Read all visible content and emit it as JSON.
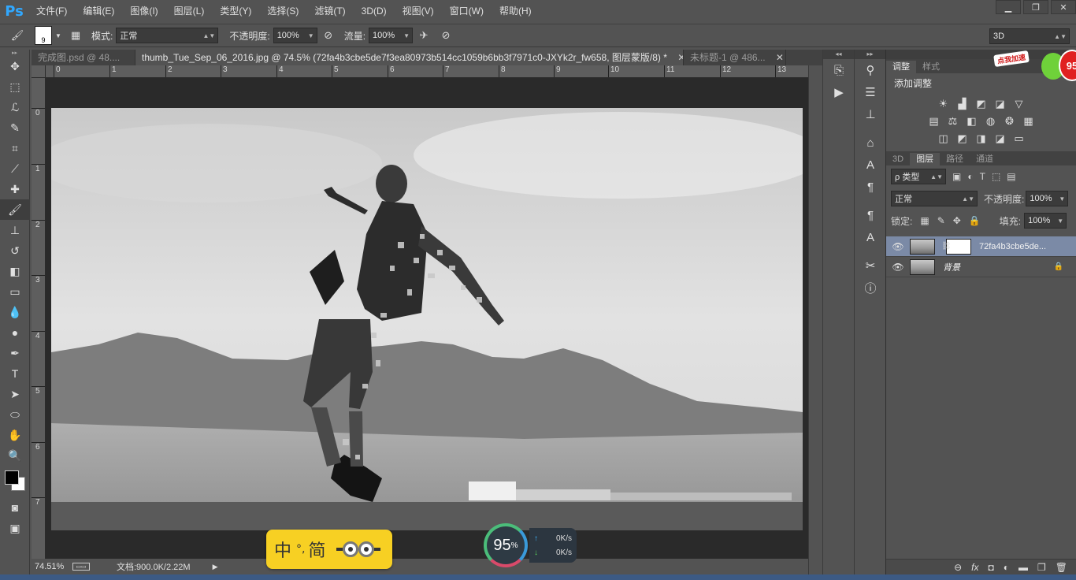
{
  "app": {
    "logo": "Ps",
    "menu": [
      "文件(F)",
      "编辑(E)",
      "图像(I)",
      "图层(L)",
      "类型(Y)",
      "选择(S)",
      "滤镜(T)",
      "3D(D)",
      "视图(V)",
      "窗口(W)",
      "帮助(H)"
    ],
    "window_controls": [
      "▁",
      "❐",
      "✕"
    ]
  },
  "options": {
    "brush_size": "9",
    "mode_label": "模式:",
    "mode_value": "正常",
    "opacity_label": "不透明度:",
    "opacity_value": "100%",
    "flow_label": "流量:",
    "flow_value": "100%",
    "workspace": "3D"
  },
  "tabs": [
    {
      "title": "完成图.psd @ 48....",
      "close": "✕"
    },
    {
      "title": "thumb_Tue_Sep_06_2016.jpg @ 74.5% (72fa4b3cbe5de7f3ea80973b514cc1059b6bb3f7971c0-JXYk2r_fw658, 图层蒙版/8) *",
      "close": "✕"
    },
    {
      "title": "未标题-1 @ 486...",
      "close": "✕"
    }
  ],
  "ruler_top": [
    "0",
    "1",
    "2",
    "3",
    "4",
    "5",
    "6",
    "7",
    "8",
    "9",
    "10",
    "11",
    "12",
    "13"
  ],
  "ruler_left": [
    "0",
    "1",
    "2",
    "3",
    "4",
    "5",
    "6",
    "7"
  ],
  "status": {
    "zoom": "74.51%",
    "doc": "文档:900.0K/2.22M"
  },
  "ime": {
    "lang": "中",
    "punct": "°,",
    "mode": "简"
  },
  "speed": {
    "percent": "95",
    "unit": "%",
    "up": "0K/s",
    "down": "0K/s"
  },
  "panels": {
    "adjust_tabs": [
      "调整",
      "样式"
    ],
    "adjust_title": "添加调整",
    "layer_tabs": [
      "3D",
      "图层",
      "路径",
      "通道"
    ],
    "filter_label": "ρ 类型",
    "blend_mode": "正常",
    "opacity_label": "不透明度:",
    "opacity_value": "100%",
    "lock_label": "锁定:",
    "fill_label": "填充:",
    "fill_value": "100%",
    "layers": [
      {
        "name": "72fa4b3cbe5de..."
      },
      {
        "name": "背景"
      }
    ],
    "bottom_icons": [
      "⊖",
      "fx",
      "◘",
      "◐",
      "▬",
      "❐",
      "🗑"
    ]
  },
  "promo": {
    "label": "点我加速",
    "num": "95"
  },
  "colors": {
    "accent": "#31a8ff",
    "selected_layer": "#7b8aa6"
  }
}
